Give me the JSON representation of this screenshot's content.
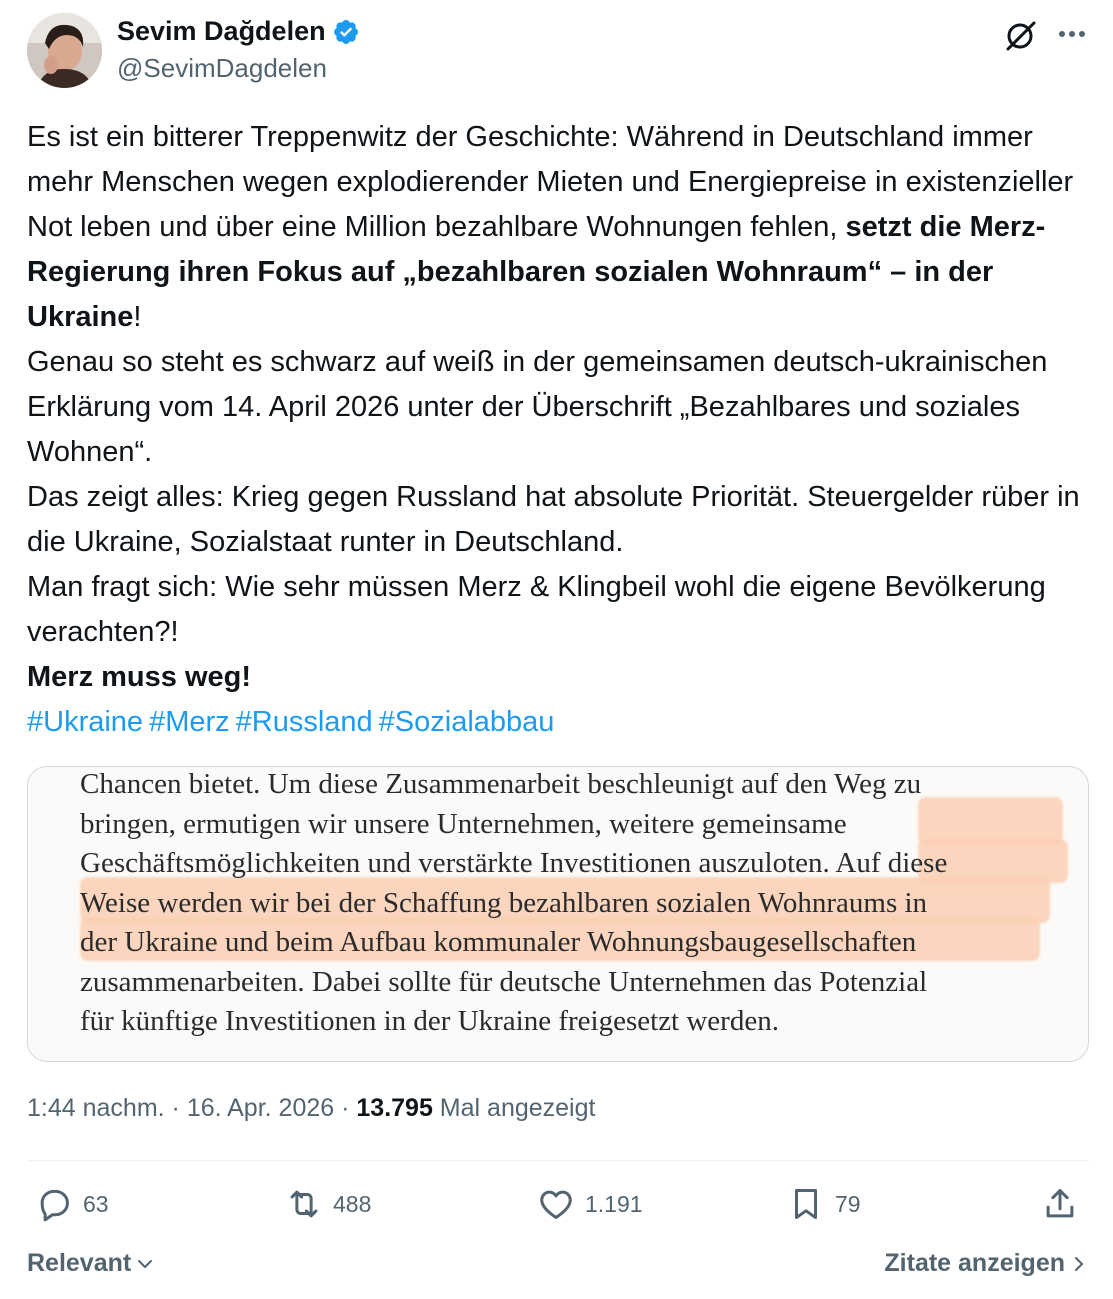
{
  "author": {
    "name": "Sevim Dağdelen",
    "handle": "@SevimDagdelen",
    "verified": true
  },
  "tweet": {
    "paragraphs": {
      "p1_a": "Es ist ein bitterer Treppenwitz der Geschichte: Während in Deutschland immer mehr Menschen wegen explodierender Mieten und Energiepreise in existenzieller Not leben und über eine Million bezahlbare Wohnungen fehlen, ",
      "p1_bold": "setzt die Merz-Regierung ihren Fokus auf „bezahlbaren sozialen Wohnraum“ – in der Ukraine",
      "p1_end": "!",
      "p2": "Genau so steht es schwarz auf weiß in der gemeinsamen deutsch-ukrainischen Erklärung vom 14. April 2026 unter der Überschrift „Bezahlbares und soziales Wohnen“.",
      "p3": "Das zeigt alles: Krieg gegen Russland hat absolute Priorität. Steuergelder rüber in die Ukraine, Sozialstaat runter in Deutschland.",
      "p4": "Man fragt sich: Wie sehr müssen Merz & Klingbeil wohl die eigene Bevölkerung verachten?!",
      "p5_bold": "Merz muss weg!"
    },
    "hashtags": [
      "#Ukraine",
      "#Merz",
      "#Russland",
      "#Sozialabbau"
    ]
  },
  "media": {
    "lines": [
      "Chancen bietet. Um diese Zusammenarbeit beschleunigt auf den Weg zu",
      "bringen, ermutigen wir unsere Unternehmen, weitere gemeinsame",
      "Geschäftsmöglichkeiten und verstärkte Investitionen auszuloten. Auf diese",
      "Weise werden wir bei der Schaffung bezahlbaren sozialen Wohnraums in",
      "der Ukraine und beim Aufbau kommunaler Wohnungsbaugesellschaften",
      "zusammenarbeiten. Dabei sollte für deutsche Unternehmen das Potenzial",
      "für künftige Investitionen in der Ukraine freigesetzt werden."
    ],
    "highlight_color": "#fbcfb3"
  },
  "meta": {
    "time": "1:44 nachm.",
    "sep1": " · ",
    "date": "16. Apr. 2026",
    "sep2": " · ",
    "views_count": "13.795",
    "views_label": " Mal angezeigt"
  },
  "actions": {
    "replies": "63",
    "reposts": "488",
    "likes": "1.191",
    "bookmarks": "79"
  },
  "footer": {
    "sort_label": "Relevant",
    "quotes_label": "Zitate anzeigen"
  },
  "colors": {
    "link": "#1d9bf0",
    "verified": "#1d9bf0",
    "muted": "#536471",
    "text": "#0f1419"
  }
}
